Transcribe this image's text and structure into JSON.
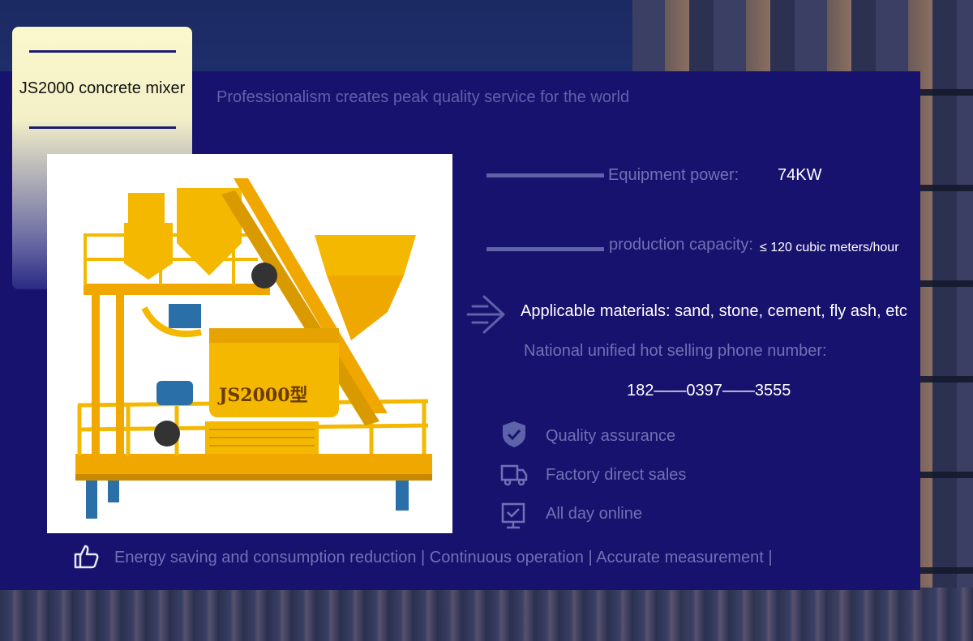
{
  "title_card": {
    "title": "JS2000 concrete mixer"
  },
  "slogan": "Professionalism creates peak quality service for the world",
  "specs": [
    {
      "label": "Equipment power:",
      "value": "74KW"
    },
    {
      "label": "production capacity:",
      "value": "≤ 120 cubic meters/hour"
    }
  ],
  "materials": "Applicable materials: sand, stone, cement, fly ash, etc",
  "phone": {
    "label": "National unified hot selling phone number:",
    "number": "182——0397——3555"
  },
  "features": [
    {
      "icon": "shield-check-icon",
      "label": "Quality assurance"
    },
    {
      "icon": "delivery-truck-icon",
      "label": "Factory direct sales"
    },
    {
      "icon": "monitor-check-icon",
      "label": "All day online"
    }
  ],
  "footer": {
    "icon": "thumbs-up-icon",
    "text": "Energy saving and consumption reduction | Continuous operation | Accurate measurement |"
  },
  "product_image": {
    "marking": "JS2000型"
  },
  "colors": {
    "panel": "#18126f",
    "muted_text": "#6e72b4",
    "machine_yellow": "#f5b800"
  }
}
